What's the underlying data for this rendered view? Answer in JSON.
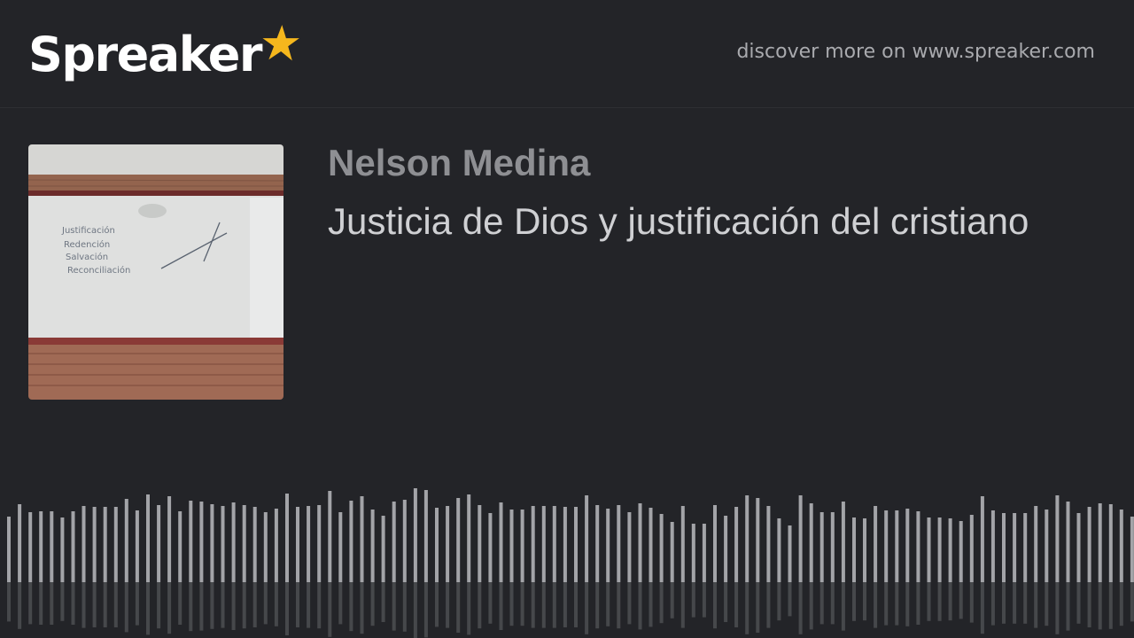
{
  "brand": {
    "name": "Spreaker",
    "star_color": "#f5b71d",
    "logo_icon": "star-icon"
  },
  "header": {
    "discover_text": "discover more on www.spreaker.com"
  },
  "episode": {
    "author": "Nelson Medina",
    "title": "Justicia de Dios y justificación del cristiano",
    "cover": {
      "icon": "whiteboard-photo",
      "whiteboard_lines": [
        "Justificación",
        "Redención",
        "Salvación",
        "Reconciliación"
      ]
    }
  },
  "waveform": {
    "color": "#a3a4a8",
    "levels": [
      0.74,
      0.88,
      0.79,
      0.8,
      0.8,
      0.73,
      0.8,
      0.86,
      0.85,
      0.85,
      0.85,
      0.94,
      0.81,
      0.99,
      0.87,
      0.97,
      0.8,
      0.92,
      0.91,
      0.88,
      0.86,
      0.9,
      0.87,
      0.85,
      0.79,
      0.83,
      1.0,
      0.85,
      0.86,
      0.87,
      1.03,
      0.79,
      0.92,
      0.97,
      0.82,
      0.75,
      0.91,
      0.93,
      1.06,
      1.04,
      0.84,
      0.86,
      0.95,
      0.99,
      0.87,
      0.78,
      0.9,
      0.82,
      0.82,
      0.86,
      0.86,
      0.86,
      0.85,
      0.85,
      0.98,
      0.87,
      0.83,
      0.87,
      0.79,
      0.89,
      0.84,
      0.77,
      0.68,
      0.86,
      0.66,
      0.66,
      0.87,
      0.75,
      0.85,
      0.98,
      0.95,
      0.86,
      0.72,
      0.64,
      0.98,
      0.89,
      0.79,
      0.79,
      0.91,
      0.73,
      0.72,
      0.86,
      0.81,
      0.81,
      0.83,
      0.8,
      0.73,
      0.73,
      0.72,
      0.69,
      0.76,
      0.97,
      0.81,
      0.78,
      0.78,
      0.78,
      0.86,
      0.82,
      0.98,
      0.91,
      0.78,
      0.85,
      0.89,
      0.88,
      0.82,
      0.74
    ]
  }
}
